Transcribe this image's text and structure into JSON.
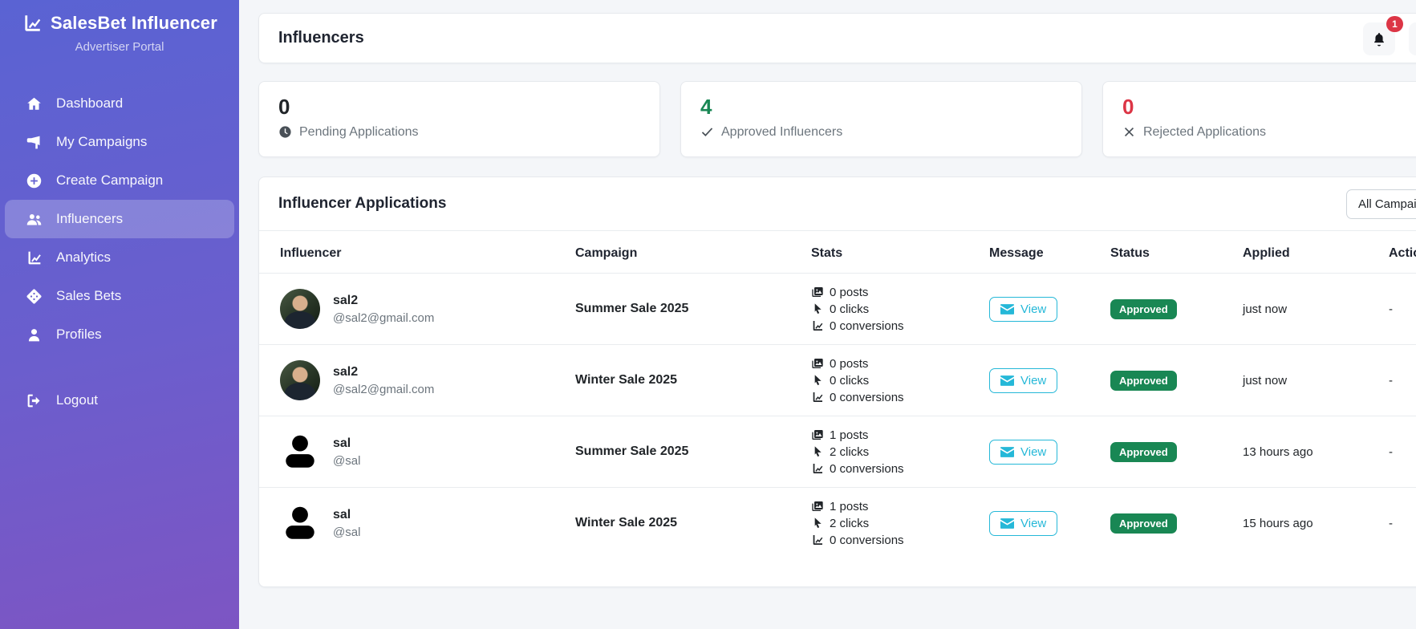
{
  "brand": {
    "title": "SalesBet Influencer",
    "subtitle": "Advertiser Portal"
  },
  "sidebar": {
    "items": [
      {
        "label": "Dashboard",
        "icon": "home-icon",
        "active": false
      },
      {
        "label": "My Campaigns",
        "icon": "megaphone-icon",
        "active": false
      },
      {
        "label": "Create Campaign",
        "icon": "plus-circle-icon",
        "active": false
      },
      {
        "label": "Influencers",
        "icon": "users-icon",
        "active": true
      },
      {
        "label": "Analytics",
        "icon": "chart-line-icon",
        "active": false
      },
      {
        "label": "Sales Bets",
        "icon": "dice-icon",
        "active": false
      },
      {
        "label": "Profiles",
        "icon": "user-icon",
        "active": false
      },
      {
        "label": "Logout",
        "icon": "logout-icon",
        "active": false
      }
    ]
  },
  "header": {
    "title": "Influencers",
    "notification_count": "1"
  },
  "stats": [
    {
      "value": "0",
      "label": "Pending Applications",
      "icon": "clock-icon",
      "color": "#212529"
    },
    {
      "value": "4",
      "label": "Approved Influencers",
      "icon": "check-icon",
      "color": "#198754"
    },
    {
      "value": "0",
      "label": "Rejected Applications",
      "icon": "x-icon",
      "color": "#dc3545"
    }
  ],
  "applications": {
    "title": "Influencer Applications",
    "filter_value": "All Campaigns",
    "columns": [
      "Influencer",
      "Campaign",
      "Stats",
      "Message",
      "Status",
      "Applied",
      "Actions"
    ],
    "rows": [
      {
        "avatar": "photo",
        "name": "sal2",
        "handle": "@sal2@gmail.com",
        "campaign": "Summer Sale 2025",
        "posts": "0 posts",
        "clicks": "0 clicks",
        "conversions": "0 conversions",
        "message_label": "View",
        "status": "Approved",
        "applied": "just now",
        "actions": "-"
      },
      {
        "avatar": "photo",
        "name": "sal2",
        "handle": "@sal2@gmail.com",
        "campaign": "Winter Sale 2025",
        "posts": "0 posts",
        "clicks": "0 clicks",
        "conversions": "0 conversions",
        "message_label": "View",
        "status": "Approved",
        "applied": "just now",
        "actions": "-"
      },
      {
        "avatar": "silhouette",
        "name": "sal",
        "handle": "@sal",
        "campaign": "Summer Sale 2025",
        "posts": "1 posts",
        "clicks": "2 clicks",
        "conversions": "0 conversions",
        "message_label": "View",
        "status": "Approved",
        "applied": "13 hours ago",
        "actions": "-"
      },
      {
        "avatar": "silhouette",
        "name": "sal",
        "handle": "@sal",
        "campaign": "Winter Sale 2025",
        "posts": "1 posts",
        "clicks": "2 clicks",
        "conversions": "0 conversions",
        "message_label": "View",
        "status": "Approved",
        "applied": "15 hours ago",
        "actions": "-"
      }
    ]
  },
  "colors": {
    "sidebar_gradient_top": "#5a63d3",
    "sidebar_gradient_bottom": "#7d55c3",
    "success": "#198754",
    "danger": "#dc3545",
    "info": "#25b8d8",
    "page_background": "#f4f6f9"
  }
}
